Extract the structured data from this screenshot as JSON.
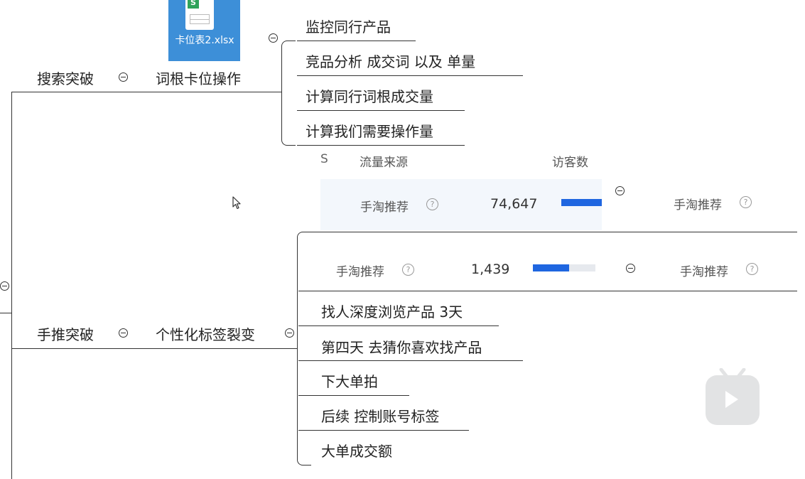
{
  "file": {
    "name": "卡位表2.xlsx",
    "badge": "S"
  },
  "branch1": {
    "label": "搜索突破",
    "child": "词根卡位操作",
    "leaves": [
      "监控同行产品",
      "竞品分析  成交词  以及 单量",
      "计算同行词根成交量",
      "计算我们需要操作量"
    ]
  },
  "traffic_header": {
    "partial_left": "S",
    "source_col": "流量来源",
    "visitors_col": "访客数"
  },
  "traffic_row1": {
    "source": "手淘推荐",
    "value": "74,647",
    "bar_fraction": 1.0,
    "side_label": "手淘推荐"
  },
  "traffic_row2": {
    "source": "手淘推荐",
    "value": "1,439",
    "bar_fraction": 0.58,
    "side_label": "手淘推荐"
  },
  "branch2": {
    "label": "手推突破",
    "child": "个性化标签裂变",
    "leaves": [
      "找人深度浏览产品  3天",
      "第四天  去猜你喜欢找产品",
      "下大单拍",
      "后续 控制账号标签",
      "大单成交额"
    ]
  },
  "help_glyph": "?",
  "colors": {
    "accent": "#1f66e0",
    "file_icon": "#3d8fd8"
  }
}
